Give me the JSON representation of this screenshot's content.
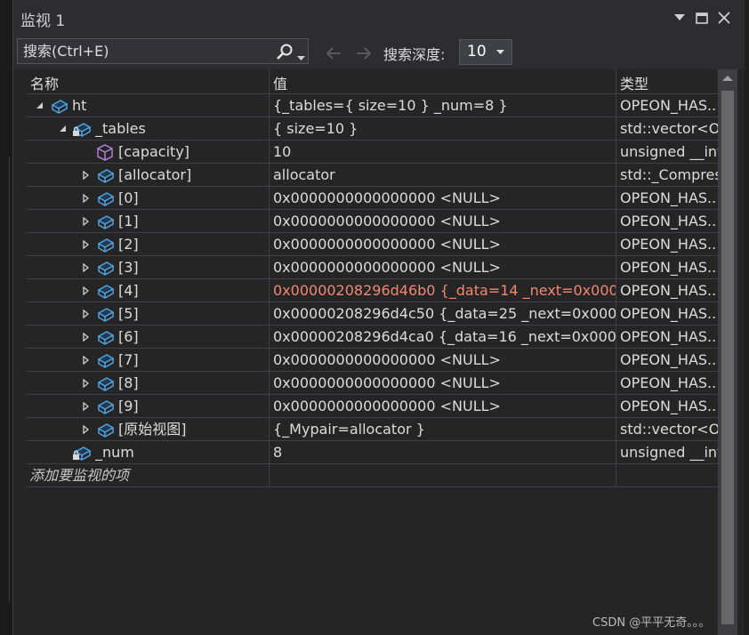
{
  "window": {
    "title": "监视 1"
  },
  "toolbar": {
    "search_placeholder": "搜索(Ctrl+E)",
    "depth_label": "搜索深度:",
    "depth_value": "10"
  },
  "columns": {
    "name": "名称",
    "value": "值",
    "type": "类型"
  },
  "rows": [
    {
      "level": 0,
      "expander": "expanded",
      "icon": "variable-icon",
      "lock": false,
      "name": "ht",
      "value": "{_tables={ size=10 } _num=8 }",
      "type": "OPEON_HAS...",
      "changed": false
    },
    {
      "level": 1,
      "expander": "expanded",
      "icon": "variable-icon",
      "lock": true,
      "name": "_tables",
      "value": "{ size=10 }",
      "type": "std::vector<O...",
      "changed": false
    },
    {
      "level": 2,
      "expander": "none",
      "icon": "cube-icon",
      "lock": false,
      "name": "[capacity]",
      "value": "10",
      "type": "unsigned __int...",
      "changed": false
    },
    {
      "level": 2,
      "expander": "collapsed",
      "icon": "variable-icon",
      "lock": false,
      "name": "[allocator]",
      "value": "allocator",
      "type": "std::_Compress...",
      "changed": false
    },
    {
      "level": 2,
      "expander": "collapsed",
      "icon": "variable-icon",
      "lock": false,
      "name": "[0]",
      "value": "0x0000000000000000 <NULL>",
      "type": "OPEON_HAS...",
      "changed": false
    },
    {
      "level": 2,
      "expander": "collapsed",
      "icon": "variable-icon",
      "lock": false,
      "name": "[1]",
      "value": "0x0000000000000000 <NULL>",
      "type": "OPEON_HAS...",
      "changed": false
    },
    {
      "level": 2,
      "expander": "collapsed",
      "icon": "variable-icon",
      "lock": false,
      "name": "[2]",
      "value": "0x0000000000000000 <NULL>",
      "type": "OPEON_HAS...",
      "changed": false
    },
    {
      "level": 2,
      "expander": "collapsed",
      "icon": "variable-icon",
      "lock": false,
      "name": "[3]",
      "value": "0x0000000000000000 <NULL>",
      "type": "OPEON_HAS...",
      "changed": false
    },
    {
      "level": 2,
      "expander": "collapsed",
      "icon": "variable-icon",
      "lock": false,
      "name": "[4]",
      "value": "0x00000208296d46b0 {_data=14 _next=0x000...",
      "type": "OPEON_HAS...",
      "changed": true
    },
    {
      "level": 2,
      "expander": "collapsed",
      "icon": "variable-icon",
      "lock": false,
      "name": "[5]",
      "value": "0x00000208296d4c50 {_data=25 _next=0x000...",
      "type": "OPEON_HAS...",
      "changed": false
    },
    {
      "level": 2,
      "expander": "collapsed",
      "icon": "variable-icon",
      "lock": false,
      "name": "[6]",
      "value": "0x00000208296d4ca0 {_data=16 _next=0x000...",
      "type": "OPEON_HAS...",
      "changed": false
    },
    {
      "level": 2,
      "expander": "collapsed",
      "icon": "variable-icon",
      "lock": false,
      "name": "[7]",
      "value": "0x0000000000000000 <NULL>",
      "type": "OPEON_HAS...",
      "changed": false
    },
    {
      "level": 2,
      "expander": "collapsed",
      "icon": "variable-icon",
      "lock": false,
      "name": "[8]",
      "value": "0x0000000000000000 <NULL>",
      "type": "OPEON_HAS...",
      "changed": false
    },
    {
      "level": 2,
      "expander": "collapsed",
      "icon": "variable-icon",
      "lock": false,
      "name": "[9]",
      "value": "0x0000000000000000 <NULL>",
      "type": "OPEON_HAS...",
      "changed": false
    },
    {
      "level": 2,
      "expander": "collapsed",
      "icon": "variable-icon",
      "lock": false,
      "name": "[原始视图]",
      "value": "{_Mypair=allocator }",
      "type": "std::vector<O...",
      "changed": false
    },
    {
      "level": 1,
      "expander": "none",
      "icon": "variable-icon",
      "lock": true,
      "name": "_num",
      "value": "8",
      "type": "unsigned __int...",
      "changed": false
    }
  ],
  "add_item_placeholder": "添加要监视的项",
  "watermark": "CSDN @平平无奇。。。",
  "colors": {
    "changed_value": "#f48771",
    "icon_blue": "#4fa3e0",
    "icon_purple": "#b180d7"
  }
}
